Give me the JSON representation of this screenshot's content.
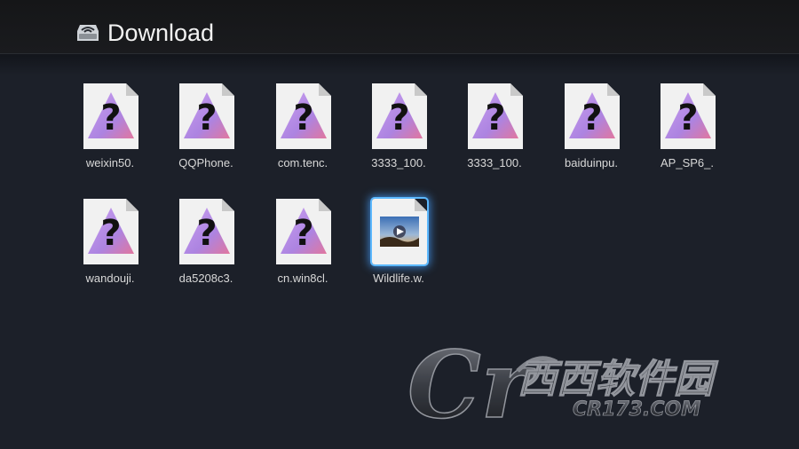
{
  "header": {
    "title": "Download",
    "icon": "download-drive-icon"
  },
  "files": [
    {
      "label": "weixin50.",
      "type": "unknown"
    },
    {
      "label": "QQPhone.",
      "type": "unknown"
    },
    {
      "label": "com.tenc.",
      "type": "unknown"
    },
    {
      "label": "3333_100.",
      "type": "unknown"
    },
    {
      "label": "3333_100.",
      "type": "unknown"
    },
    {
      "label": "baiduinpu.",
      "type": "unknown"
    },
    {
      "label": "AP_SP6_.",
      "type": "unknown"
    },
    {
      "label": "wandouji.",
      "type": "unknown"
    },
    {
      "label": "da5208c3.",
      "type": "unknown"
    },
    {
      "label": "cn.win8cl.",
      "type": "unknown"
    },
    {
      "label": "Wildlife.w.",
      "type": "video",
      "selected": true
    }
  ],
  "watermark": {
    "latin": "Cr",
    "chinese": "西西软件园",
    "domain": "CR173.COM"
  },
  "colors": {
    "background": "#1c2029",
    "header": "#18191c",
    "selection_glow": "#5cb8ff",
    "label_text": "#d8d8d8"
  }
}
